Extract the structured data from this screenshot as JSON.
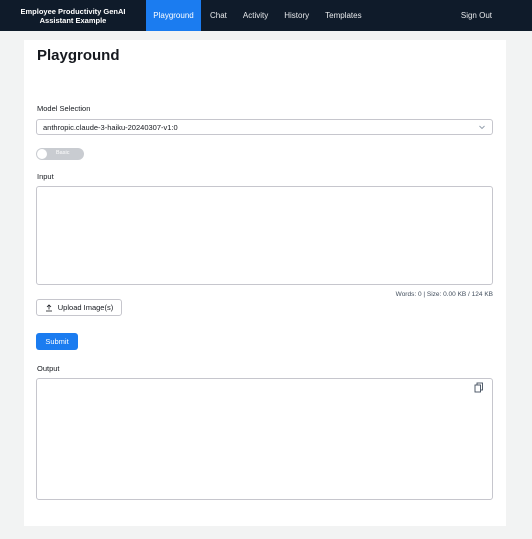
{
  "nav": {
    "brand": "Employee Productivity GenAI Assistant Example",
    "items": [
      {
        "label": "Playground"
      },
      {
        "label": "Chat"
      },
      {
        "label": "Activity"
      },
      {
        "label": "History"
      },
      {
        "label": "Templates"
      }
    ],
    "signout": "Sign Out",
    "active_color": "#1b7cf0",
    "bg_color": "#0f1b2a"
  },
  "page": {
    "title": "Playground"
  },
  "model": {
    "label": "Model Selection",
    "selected": "anthropic.claude-3-haiku-20240307-v1:0",
    "icon": "chevron-down-icon"
  },
  "toggle": {
    "label": "Basic",
    "state": "off"
  },
  "input": {
    "label": "Input",
    "value": "",
    "counter": "Words: 0 | Size: 0.00 KB / 124 KB"
  },
  "upload": {
    "label": "Upload Image(s)",
    "icon": "upload-icon"
  },
  "submit": {
    "label": "Submit"
  },
  "output": {
    "label": "Output",
    "icon": "copy-icon"
  }
}
